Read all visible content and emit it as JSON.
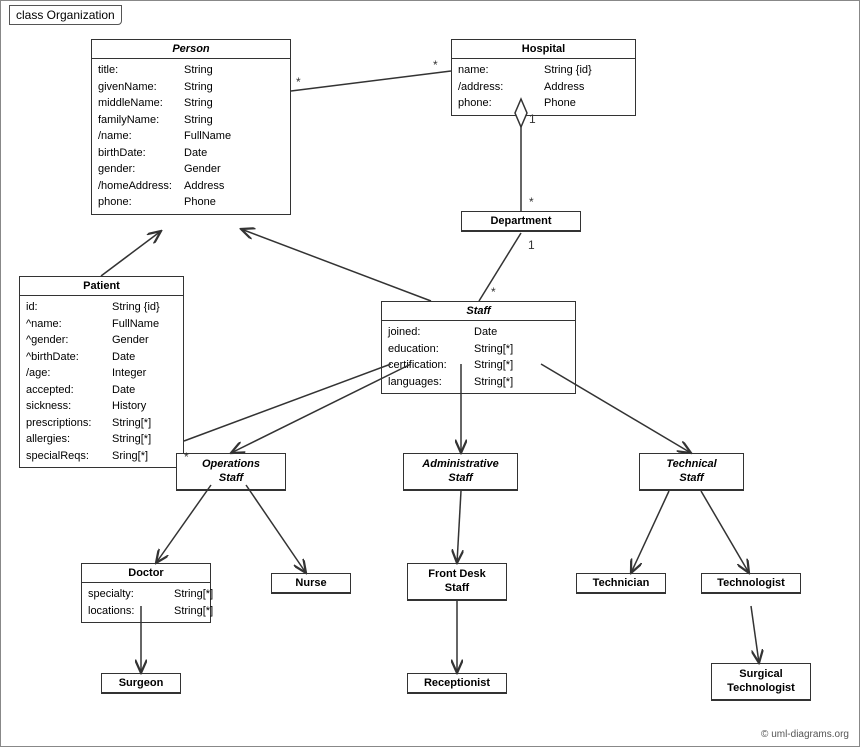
{
  "title": "class Organization",
  "copyright": "© uml-diagrams.org",
  "classes": {
    "person": {
      "name": "Person",
      "italic": true,
      "attrs": [
        {
          "name": "title:",
          "type": "String"
        },
        {
          "name": "givenName:",
          "type": "String"
        },
        {
          "name": "middleName:",
          "type": "String"
        },
        {
          "name": "familyName:",
          "type": "String"
        },
        {
          "name": "/name:",
          "type": "FullName"
        },
        {
          "name": "birthDate:",
          "type": "Date"
        },
        {
          "name": "gender:",
          "type": "Gender"
        },
        {
          "name": "/homeAddress:",
          "type": "Address"
        },
        {
          "name": "phone:",
          "type": "Phone"
        }
      ]
    },
    "hospital": {
      "name": "Hospital",
      "italic": false,
      "attrs": [
        {
          "name": "name:",
          "type": "String {id}"
        },
        {
          "name": "/address:",
          "type": "Address"
        },
        {
          "name": "phone:",
          "type": "Phone"
        }
      ]
    },
    "department": {
      "name": "Department",
      "italic": false,
      "attrs": []
    },
    "staff": {
      "name": "Staff",
      "italic": true,
      "attrs": [
        {
          "name": "joined:",
          "type": "Date"
        },
        {
          "name": "education:",
          "type": "String[*]"
        },
        {
          "name": "certification:",
          "type": "String[*]"
        },
        {
          "name": "languages:",
          "type": "String[*]"
        }
      ]
    },
    "patient": {
      "name": "Patient",
      "italic": false,
      "attrs": [
        {
          "name": "id:",
          "type": "String {id}"
        },
        {
          "name": "^name:",
          "type": "FullName"
        },
        {
          "name": "^gender:",
          "type": "Gender"
        },
        {
          "name": "^birthDate:",
          "type": "Date"
        },
        {
          "name": "/age:",
          "type": "Integer"
        },
        {
          "name": "accepted:",
          "type": "Date"
        },
        {
          "name": "sickness:",
          "type": "History"
        },
        {
          "name": "prescriptions:",
          "type": "String[*]"
        },
        {
          "name": "allergies:",
          "type": "String[*]"
        },
        {
          "name": "specialReqs:",
          "type": "Sring[*]"
        }
      ]
    },
    "operationsStaff": {
      "name": "Operations\nStaff",
      "italic": true,
      "attrs": []
    },
    "administrativeStaff": {
      "name": "Administrative\nStaff",
      "italic": true,
      "attrs": []
    },
    "technicalStaff": {
      "name": "Technical\nStaff",
      "italic": true,
      "attrs": []
    },
    "doctor": {
      "name": "Doctor",
      "italic": false,
      "attrs": [
        {
          "name": "specialty:",
          "type": "String[*]"
        },
        {
          "name": "locations:",
          "type": "String[*]"
        }
      ]
    },
    "nurse": {
      "name": "Nurse",
      "italic": false,
      "attrs": []
    },
    "frontDeskStaff": {
      "name": "Front Desk\nStaff",
      "italic": false,
      "attrs": []
    },
    "technician": {
      "name": "Technician",
      "italic": false,
      "attrs": []
    },
    "technologist": {
      "name": "Technologist",
      "italic": false,
      "attrs": []
    },
    "surgeon": {
      "name": "Surgeon",
      "italic": false,
      "attrs": []
    },
    "receptionist": {
      "name": "Receptionist",
      "italic": false,
      "attrs": []
    },
    "surgicalTechnologist": {
      "name": "Surgical\nTechnologist",
      "italic": false,
      "attrs": []
    }
  }
}
